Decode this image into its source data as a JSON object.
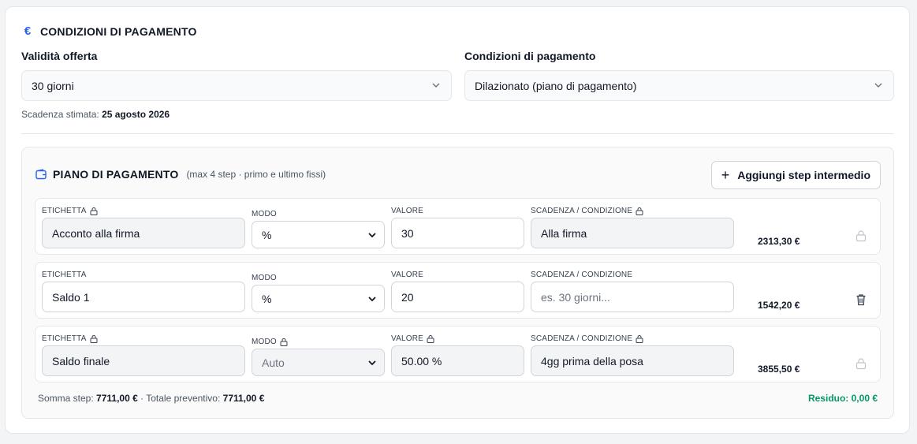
{
  "section": {
    "title": "CONDIZIONI DI PAGAMENTO",
    "validity_label": "Validità offerta",
    "validity_value": "30 giorni",
    "terms_label": "Condizioni di pagamento",
    "terms_value": "Dilazionato (piano di pagamento)",
    "expiry_prefix": "Scadenza stimata:",
    "expiry_date": "25 agosto 2026"
  },
  "plan": {
    "title": "PIANO DI PAGAMENTO",
    "subtitle": "(max 4 step · primo e ultimo fissi)",
    "add_button": "Aggiungi step intermedio",
    "col_label": "ETICHETTA",
    "col_mode": "MODO",
    "col_value": "VALORE",
    "col_due": "SCADENZA / CONDIZIONE",
    "steps": [
      {
        "label": "Acconto alla firma",
        "mode": "%",
        "value": "30",
        "due": "Alla firma",
        "amount": "2313,30 €"
      },
      {
        "label": "Saldo 1",
        "mode": "%",
        "value": "20",
        "due_placeholder": "es. 30 giorni...",
        "amount": "1542,20 €"
      },
      {
        "label": "Saldo finale",
        "mode": "Auto",
        "value": "50.00 %",
        "due": "4gg prima della posa",
        "amount": "3855,50 €"
      }
    ],
    "sum_label": "Somma step:",
    "sum_value": "7711,00 €",
    "total_label": "· Totale preventivo:",
    "total_value": "7711,00 €",
    "residual": "Residuo: 0,00 €"
  },
  "colors": {
    "accent": "#2563eb",
    "success": "#059669"
  }
}
